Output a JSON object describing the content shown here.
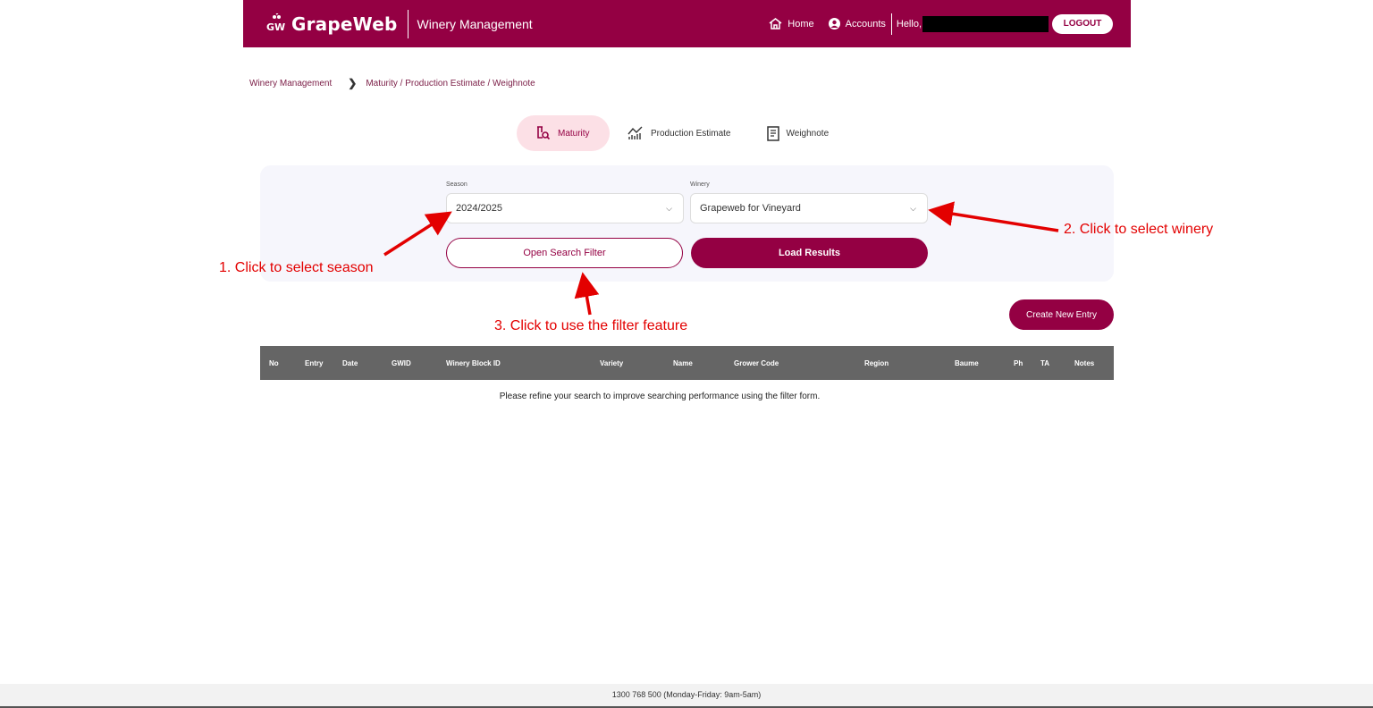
{
  "header": {
    "logo_text": "GrapeWeb",
    "logo_mark_text": "GW",
    "app_name": "Winery Management",
    "nav": {
      "home": "Home",
      "accounts": "Accounts"
    },
    "hello": "Hello,",
    "logout": "LOGOUT"
  },
  "breadcrumb": {
    "root": "Winery Management",
    "current": "Maturity / Production Estimate / Weighnote"
  },
  "tabs": [
    {
      "label": "Maturity",
      "active": true
    },
    {
      "label": "Production Estimate",
      "active": false
    },
    {
      "label": "Weighnote",
      "active": false
    }
  ],
  "filters": {
    "season_label": "Season",
    "season_value": "2024/2025",
    "winery_label": "Winery",
    "winery_value": "Grapeweb for Vineyard",
    "open_filter": "Open Search Filter",
    "load_results": "Load Results"
  },
  "create_entry": "Create New Entry",
  "table": {
    "columns": [
      "No",
      "Entry",
      "Date",
      "GWID",
      "Winery Block ID",
      "Variety",
      "Name",
      "Grower Code",
      "Region",
      "Baume",
      "Ph",
      "TA",
      "Notes"
    ],
    "empty_message": "Please refine your search to improve searching performance using the filter form."
  },
  "annotations": {
    "a1": "1. Click to select season",
    "a2": "2. Click to select winery",
    "a3": "3. Click to use the filter feature"
  },
  "footer": "1300 768 500 (Monday-Friday: 9am-5am)",
  "colors": {
    "brand": "#940043",
    "annotation": "#e30000",
    "tab_active_bg": "#fce0e6"
  }
}
